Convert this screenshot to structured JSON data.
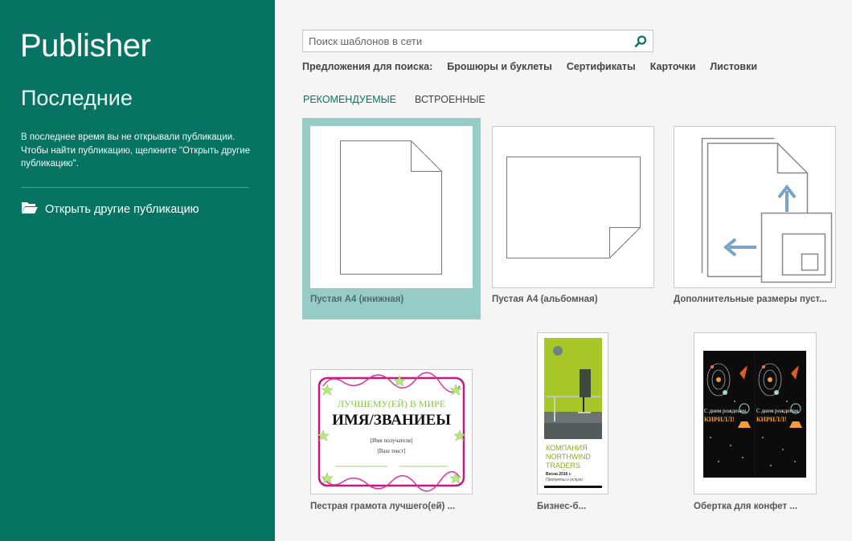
{
  "sidebar": {
    "app_title": "Publisher",
    "recent_title": "Последние",
    "recent_description": "В последнее время вы не открывали публикации. Чтобы найти публикацию, щелкните \"Открыть другие публикацию\".",
    "open_other_label": "Открыть другие публикацию",
    "open_other_icon": "folder-open-icon"
  },
  "search": {
    "placeholder": "Поиск шаблонов в сети",
    "value": "",
    "icon": "search-icon"
  },
  "suggestions": {
    "label": "Предложения для поиска:",
    "items": [
      "Брошюры и буклеты",
      "Сертификаты",
      "Карточки",
      "Листовки"
    ]
  },
  "tabs": [
    {
      "label": "РЕКОМЕНДУЕМЫЕ",
      "active": true
    },
    {
      "label": "ВСТРОЕННЫЕ",
      "active": false
    }
  ],
  "templates": [
    {
      "caption": "Пустая A4 (книжная)",
      "selected": true
    },
    {
      "caption": "Пустая A4 (альбомная)",
      "selected": false
    },
    {
      "caption": "Дополнительные размеры пуст...",
      "selected": false
    },
    {
      "caption": "Пестрая грамота лучшего(ей) ...",
      "selected": false,
      "preview": {
        "heading": "ЛУЧШЕМУ(ЕЙ) В МИРЕ",
        "title": "ИМЯ/ЗВАНИЕЫ",
        "recipient": "[Имя получателя]",
        "text": "[Ваш текст]"
      }
    },
    {
      "caption": "Бизнес-б...",
      "selected": false,
      "preview": {
        "line1": "КОМПАНИЯ",
        "line2": "NORTHWIND",
        "line3": "TRADERS",
        "season": "Весна 2016 г.",
        "subtitle": "Продукты и услуги"
      }
    },
    {
      "caption": "Обертка для конфет ...",
      "selected": false,
      "preview": {
        "greeting": "С днем рождения,",
        "name": "КИРИЛЛ!"
      }
    }
  ],
  "colors": {
    "accent": "#077463",
    "selected_tile": "#97ccc6",
    "arrow": "#7ba3c9"
  }
}
